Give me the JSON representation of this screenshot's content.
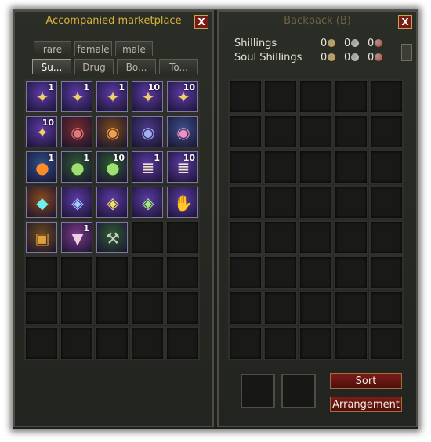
{
  "market": {
    "title": "Accompanied marketplace",
    "close_label": "X",
    "tabs_row1": [
      "rare",
      "female",
      "male"
    ],
    "tabs_row2": [
      "Su...",
      "Drug",
      "Bo...",
      "To..."
    ],
    "active_tab": "Su...",
    "items": [
      {
        "name": "wing-fragment-icon",
        "qty": "1",
        "color": "#5c3aa6"
      },
      {
        "name": "wing-fragment-icon",
        "qty": "1",
        "color": "#5c3aa6"
      },
      {
        "name": "wing-fragment-icon",
        "qty": "1",
        "color": "#5c3aa6"
      },
      {
        "name": "wing-fragment-icon",
        "qty": "10",
        "color": "#5c3aa6"
      },
      {
        "name": "wing-fragment-icon",
        "qty": "10",
        "color": "#5c3aa6"
      },
      {
        "name": "wing-fragment-icon",
        "qty": "10",
        "color": "#5c3aa6"
      },
      {
        "name": "red-pouch-icon",
        "qty": "",
        "color": "#7a2b2b"
      },
      {
        "name": "orange-pouch-icon",
        "qty": "",
        "color": "#7a4a1c"
      },
      {
        "name": "blue-pouch-icon",
        "qty": "",
        "color": "#4b3a8a"
      },
      {
        "name": "pink-pouch-icon",
        "qty": "",
        "color": "#3a4f8a"
      },
      {
        "name": "fire-orb-icon",
        "qty": "1",
        "color": "#2f4f8a"
      },
      {
        "name": "green-orb-icon",
        "qty": "1",
        "color": "#2e5a34"
      },
      {
        "name": "green-orb-icon",
        "qty": "10",
        "color": "#2e5a34"
      },
      {
        "name": "scroll-icon",
        "qty": "1",
        "color": "#5c3aa6"
      },
      {
        "name": "scroll-icon",
        "qty": "10",
        "color": "#5c3aa6"
      },
      {
        "name": "cyan-crystal-icon",
        "qty": "",
        "color": "#8a4a1c"
      },
      {
        "name": "blue-gem-icon",
        "qty": "",
        "color": "#5c3aa6"
      },
      {
        "name": "yellow-gem-icon",
        "qty": "",
        "color": "#5c3aa6"
      },
      {
        "name": "green-gem-icon",
        "qty": "",
        "color": "#5c3aa6"
      },
      {
        "name": "hand-icon",
        "qty": "",
        "color": "#5c3aa6"
      },
      {
        "name": "treasure-chest-icon",
        "qty": "",
        "color": "#6a4a1c"
      },
      {
        "name": "bucket-icon",
        "qty": "1",
        "color": "#7a3a8a"
      },
      {
        "name": "pickaxe-icon",
        "qty": "",
        "color": "#2e5a34"
      }
    ]
  },
  "backpack": {
    "title": "Backpack (B)",
    "close_label": "X",
    "currencies": [
      {
        "label": "Shillings",
        "values": [
          "0",
          "0",
          "0"
        ]
      },
      {
        "label": "Soul Shillings",
        "values": [
          "0",
          "0",
          "0"
        ]
      }
    ],
    "coin_colors": [
      "#e3a21f",
      "#c8c8c8",
      "#d23a2a"
    ],
    "sort_label": "Sort",
    "arrange_label": "Arrangement"
  }
}
